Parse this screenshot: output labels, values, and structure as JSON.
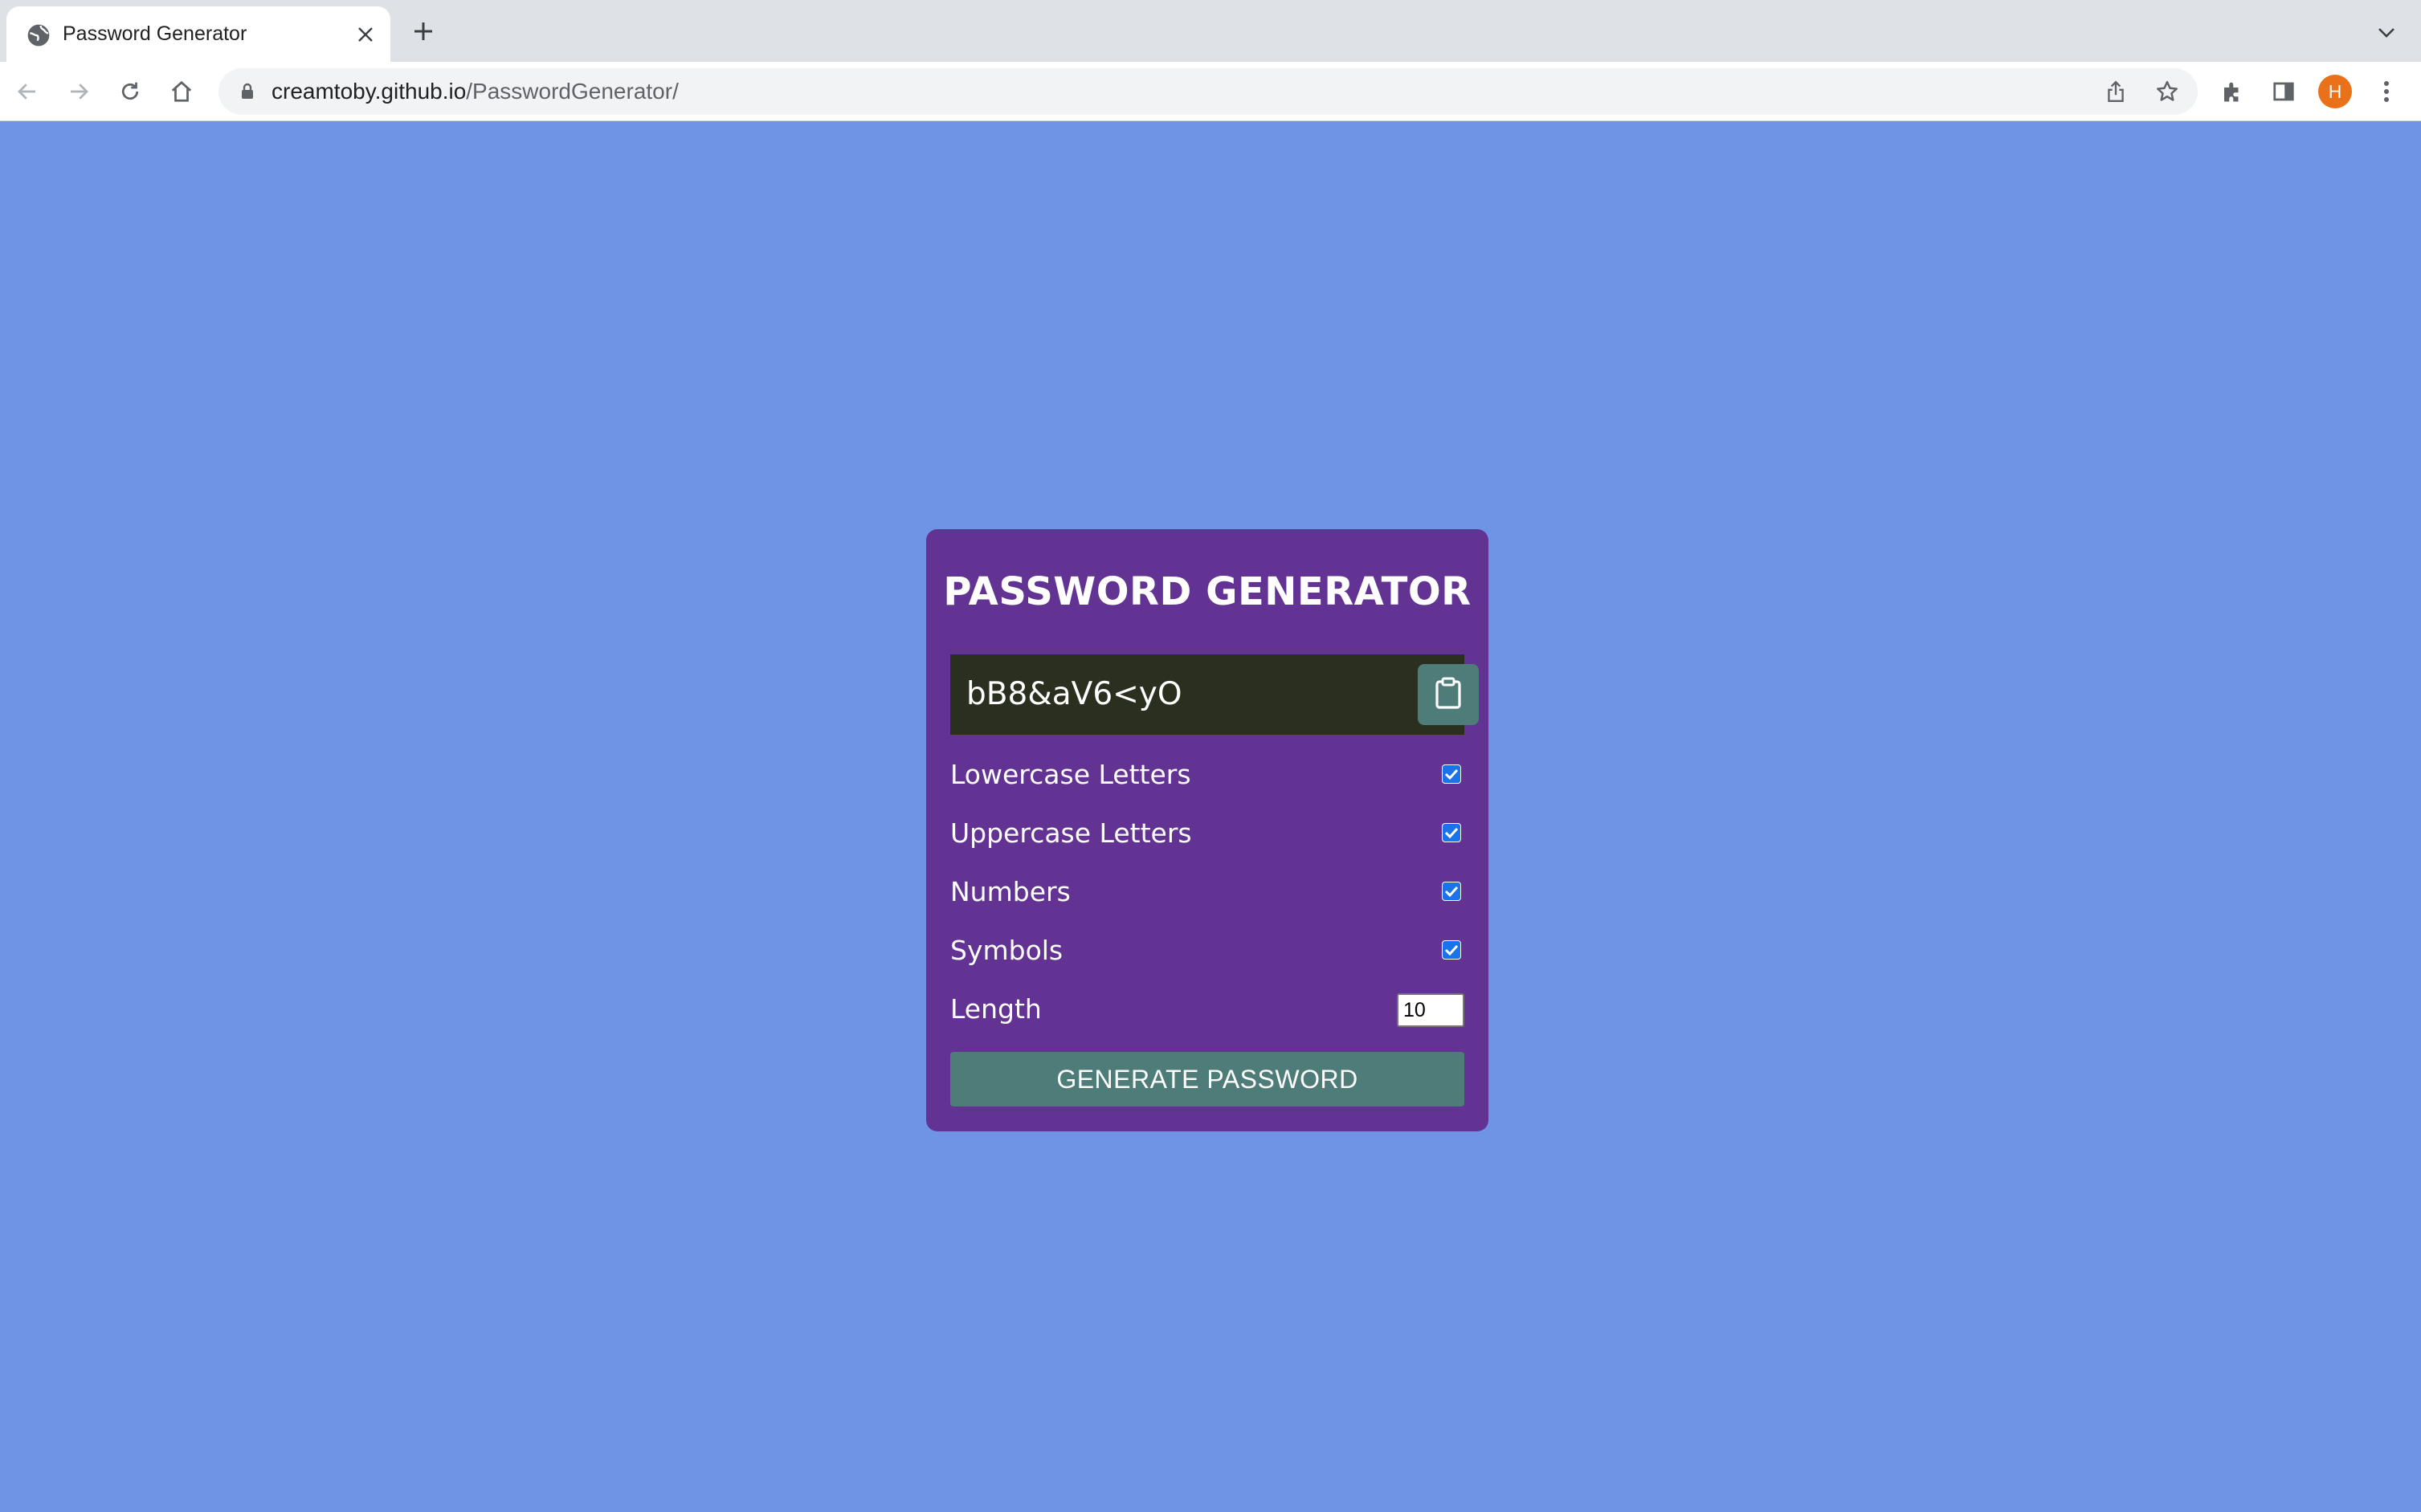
{
  "browser": {
    "tab_title": "Password Generator",
    "url_host": "creamtoby.github.io",
    "url_path": "/PasswordGenerator/",
    "profile_initial": "H"
  },
  "app": {
    "title": "PASSWORD GENERATOR",
    "password": "bB8&aV6<yO",
    "options": [
      {
        "label": "Lowercase Letters",
        "checked": true
      },
      {
        "label": "Uppercase Letters",
        "checked": true
      },
      {
        "label": "Numbers",
        "checked": true
      },
      {
        "label": "Symbols",
        "checked": true
      }
    ],
    "length_label": "Length",
    "length_value": "10",
    "generate_label": "GENERATE PASSWORD"
  },
  "colors": {
    "page_background": "#6f94e5",
    "card_background": "#633394",
    "result_background": "#2b2f1f",
    "button_background": "#4e7c78",
    "checkbox": "#1a73e8"
  },
  "icons": [
    "globe-icon",
    "close-icon",
    "plus-icon",
    "chevron-down-icon",
    "back-arrow-icon",
    "forward-arrow-icon",
    "reload-icon",
    "home-icon",
    "lock-icon",
    "share-icon",
    "star-icon",
    "extensions-icon",
    "side-panel-icon",
    "kebab-menu-icon",
    "clipboard-icon",
    "checkmark-icon"
  ]
}
